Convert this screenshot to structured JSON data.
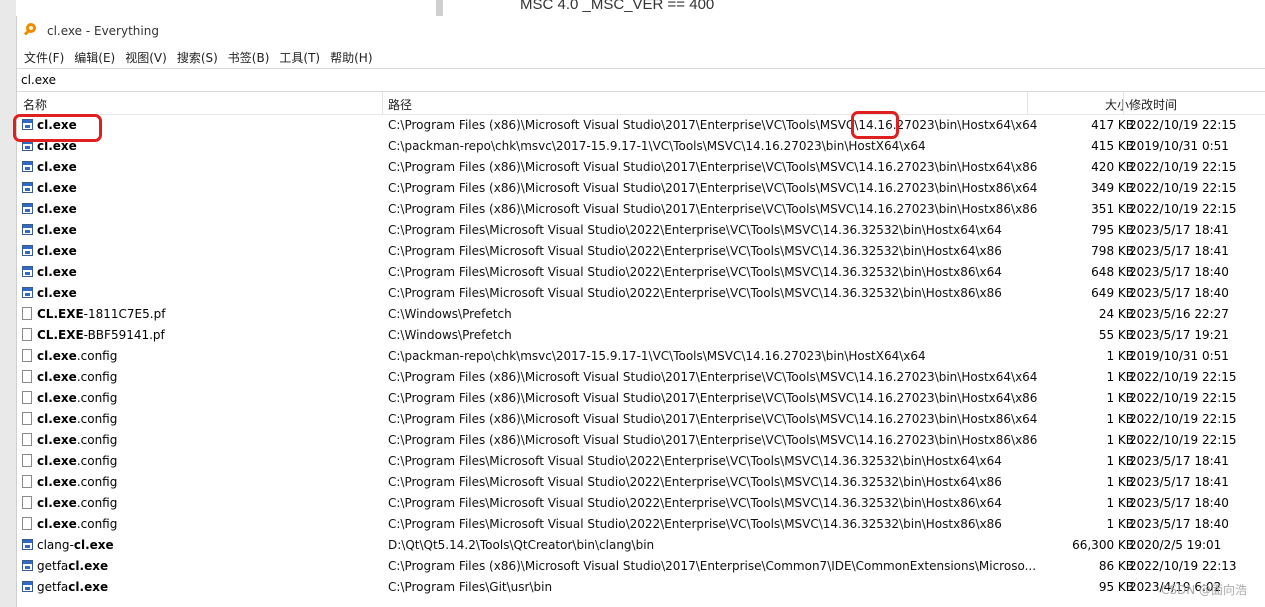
{
  "background": {
    "text": "MSC 4.0 _MSC_VER == 400"
  },
  "window": {
    "title": "cl.exe - Everything",
    "app_icon": "magnifier-icon"
  },
  "menu": [
    "文件(F)",
    "编辑(E)",
    "视图(V)",
    "搜索(S)",
    "书签(B)",
    "工具(T)",
    "帮助(H)"
  ],
  "search": {
    "value": "cl.exe"
  },
  "columns": {
    "name": "名称",
    "path": "路径",
    "size": "大小",
    "date": "修改时间"
  },
  "rows": [
    {
      "pre": "",
      "match": "cl.exe",
      "post": "",
      "icon": "exe-file-icon",
      "path": "C:\\Program Files (x86)\\Microsoft Visual Studio\\2017\\Enterprise\\VC\\Tools\\MSVC\\14.16.27023\\bin\\Hostx64\\x64",
      "size": "417 KB",
      "date": "2022/10/19 22:15"
    },
    {
      "pre": "",
      "match": "cl.exe",
      "post": "",
      "icon": "exe-file-icon",
      "path": "C:\\packman-repo\\chk\\msvc\\2017-15.9.17-1\\VC\\Tools\\MSVC\\14.16.27023\\bin\\HostX64\\x64",
      "size": "415 KB",
      "date": "2019/10/31 0:51"
    },
    {
      "pre": "",
      "match": "cl.exe",
      "post": "",
      "icon": "exe-file-icon",
      "path": "C:\\Program Files (x86)\\Microsoft Visual Studio\\2017\\Enterprise\\VC\\Tools\\MSVC\\14.16.27023\\bin\\Hostx64\\x86",
      "size": "420 KB",
      "date": "2022/10/19 22:15"
    },
    {
      "pre": "",
      "match": "cl.exe",
      "post": "",
      "icon": "exe-file-icon",
      "path": "C:\\Program Files (x86)\\Microsoft Visual Studio\\2017\\Enterprise\\VC\\Tools\\MSVC\\14.16.27023\\bin\\Hostx86\\x64",
      "size": "349 KB",
      "date": "2022/10/19 22:15"
    },
    {
      "pre": "",
      "match": "cl.exe",
      "post": "",
      "icon": "exe-file-icon",
      "path": "C:\\Program Files (x86)\\Microsoft Visual Studio\\2017\\Enterprise\\VC\\Tools\\MSVC\\14.16.27023\\bin\\Hostx86\\x86",
      "size": "351 KB",
      "date": "2022/10/19 22:15"
    },
    {
      "pre": "",
      "match": "cl.exe",
      "post": "",
      "icon": "exe-file-icon",
      "path": "C:\\Program Files\\Microsoft Visual Studio\\2022\\Enterprise\\VC\\Tools\\MSVC\\14.36.32532\\bin\\Hostx64\\x64",
      "size": "795 KB",
      "date": "2023/5/17 18:41"
    },
    {
      "pre": "",
      "match": "cl.exe",
      "post": "",
      "icon": "exe-file-icon",
      "path": "C:\\Program Files\\Microsoft Visual Studio\\2022\\Enterprise\\VC\\Tools\\MSVC\\14.36.32532\\bin\\Hostx64\\x86",
      "size": "798 KB",
      "date": "2023/5/17 18:41"
    },
    {
      "pre": "",
      "match": "cl.exe",
      "post": "",
      "icon": "exe-file-icon",
      "path": "C:\\Program Files\\Microsoft Visual Studio\\2022\\Enterprise\\VC\\Tools\\MSVC\\14.36.32532\\bin\\Hostx86\\x64",
      "size": "648 KB",
      "date": "2023/5/17 18:40"
    },
    {
      "pre": "",
      "match": "cl.exe",
      "post": "",
      "icon": "exe-file-icon",
      "path": "C:\\Program Files\\Microsoft Visual Studio\\2022\\Enterprise\\VC\\Tools\\MSVC\\14.36.32532\\bin\\Hostx86\\x86",
      "size": "649 KB",
      "date": "2023/5/17 18:40"
    },
    {
      "pre": "",
      "match": "CL.EXE",
      "post": "-1811C7E5.pf",
      "icon": "document-icon",
      "path": "C:\\Windows\\Prefetch",
      "size": "24 KB",
      "date": "2023/5/16 22:27"
    },
    {
      "pre": "",
      "match": "CL.EXE",
      "post": "-BBF59141.pf",
      "icon": "document-icon",
      "path": "C:\\Windows\\Prefetch",
      "size": "55 KB",
      "date": "2023/5/17 19:21"
    },
    {
      "pre": "",
      "match": "cl.exe",
      "post": ".config",
      "icon": "document-icon",
      "path": "C:\\packman-repo\\chk\\msvc\\2017-15.9.17-1\\VC\\Tools\\MSVC\\14.16.27023\\bin\\HostX64\\x64",
      "size": "1 KB",
      "date": "2019/10/31 0:51"
    },
    {
      "pre": "",
      "match": "cl.exe",
      "post": ".config",
      "icon": "document-icon",
      "path": "C:\\Program Files (x86)\\Microsoft Visual Studio\\2017\\Enterprise\\VC\\Tools\\MSVC\\14.16.27023\\bin\\Hostx64\\x64",
      "size": "1 KB",
      "date": "2022/10/19 22:15"
    },
    {
      "pre": "",
      "match": "cl.exe",
      "post": ".config",
      "icon": "document-icon",
      "path": "C:\\Program Files (x86)\\Microsoft Visual Studio\\2017\\Enterprise\\VC\\Tools\\MSVC\\14.16.27023\\bin\\Hostx64\\x86",
      "size": "1 KB",
      "date": "2022/10/19 22:15"
    },
    {
      "pre": "",
      "match": "cl.exe",
      "post": ".config",
      "icon": "document-icon",
      "path": "C:\\Program Files (x86)\\Microsoft Visual Studio\\2017\\Enterprise\\VC\\Tools\\MSVC\\14.16.27023\\bin\\Hostx86\\x64",
      "size": "1 KB",
      "date": "2022/10/19 22:15"
    },
    {
      "pre": "",
      "match": "cl.exe",
      "post": ".config",
      "icon": "document-icon",
      "path": "C:\\Program Files (x86)\\Microsoft Visual Studio\\2017\\Enterprise\\VC\\Tools\\MSVC\\14.16.27023\\bin\\Hostx86\\x86",
      "size": "1 KB",
      "date": "2022/10/19 22:15"
    },
    {
      "pre": "",
      "match": "cl.exe",
      "post": ".config",
      "icon": "document-icon",
      "path": "C:\\Program Files\\Microsoft Visual Studio\\2022\\Enterprise\\VC\\Tools\\MSVC\\14.36.32532\\bin\\Hostx64\\x64",
      "size": "1 KB",
      "date": "2023/5/17 18:41"
    },
    {
      "pre": "",
      "match": "cl.exe",
      "post": ".config",
      "icon": "document-icon",
      "path": "C:\\Program Files\\Microsoft Visual Studio\\2022\\Enterprise\\VC\\Tools\\MSVC\\14.36.32532\\bin\\Hostx64\\x86",
      "size": "1 KB",
      "date": "2023/5/17 18:41"
    },
    {
      "pre": "",
      "match": "cl.exe",
      "post": ".config",
      "icon": "document-icon",
      "path": "C:\\Program Files\\Microsoft Visual Studio\\2022\\Enterprise\\VC\\Tools\\MSVC\\14.36.32532\\bin\\Hostx86\\x64",
      "size": "1 KB",
      "date": "2023/5/17 18:40"
    },
    {
      "pre": "",
      "match": "cl.exe",
      "post": ".config",
      "icon": "document-icon",
      "path": "C:\\Program Files\\Microsoft Visual Studio\\2022\\Enterprise\\VC\\Tools\\MSVC\\14.36.32532\\bin\\Hostx86\\x86",
      "size": "1 KB",
      "date": "2023/5/17 18:40"
    },
    {
      "pre": "clang-",
      "match": "cl.exe",
      "post": "",
      "icon": "exe-file-icon",
      "path": "D:\\Qt\\Qt5.14.2\\Tools\\QtCreator\\bin\\clang\\bin",
      "size": "66,300 KB",
      "date": "2020/2/5 19:01"
    },
    {
      "pre": "getfa",
      "match": "cl.exe",
      "post": "",
      "icon": "exe-file-icon",
      "path": "C:\\Program Files (x86)\\Microsoft Visual Studio\\2017\\Enterprise\\Common7\\IDE\\CommonExtensions\\Microso...",
      "size": "86 KB",
      "date": "2022/10/19 22:13"
    },
    {
      "pre": "getfa",
      "match": "cl.exe",
      "post": "",
      "icon": "exe-file-icon",
      "path": "C:\\Program Files\\Git\\usr\\bin",
      "size": "95 KB",
      "date": "2023/4/19 6:02"
    }
  ],
  "watermark": "CSDN @面向浩"
}
